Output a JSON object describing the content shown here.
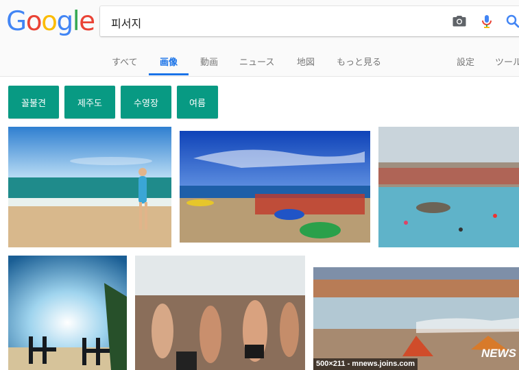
{
  "logo": {
    "letters": [
      "G",
      "o",
      "o",
      "g",
      "l",
      "e"
    ],
    "colors": [
      "#4285F4",
      "#EA4335",
      "#FBBC05",
      "#4285F4",
      "#34A853",
      "#EA4335"
    ]
  },
  "search": {
    "query": "피서지"
  },
  "tabs": [
    {
      "label": "すべて"
    },
    {
      "label": "画像",
      "active": true
    },
    {
      "label": "動画"
    },
    {
      "label": "ニュース"
    },
    {
      "label": "地図"
    },
    {
      "label": "もっと見る"
    },
    {
      "label": "設定"
    },
    {
      "label": "ツール"
    }
  ],
  "chips": [
    {
      "label": "꼴불견"
    },
    {
      "label": "제주도"
    },
    {
      "label": "수영장"
    },
    {
      "label": "여름"
    }
  ],
  "results": {
    "caption": "500×211 - mnews.joins.com",
    "watermark": "NEWS"
  },
  "icons": {
    "camera": "camera-icon",
    "mic": "microphone-icon",
    "search": "search-icon"
  },
  "colors": {
    "accent": "#1a73e8",
    "chip": "#089a83"
  }
}
